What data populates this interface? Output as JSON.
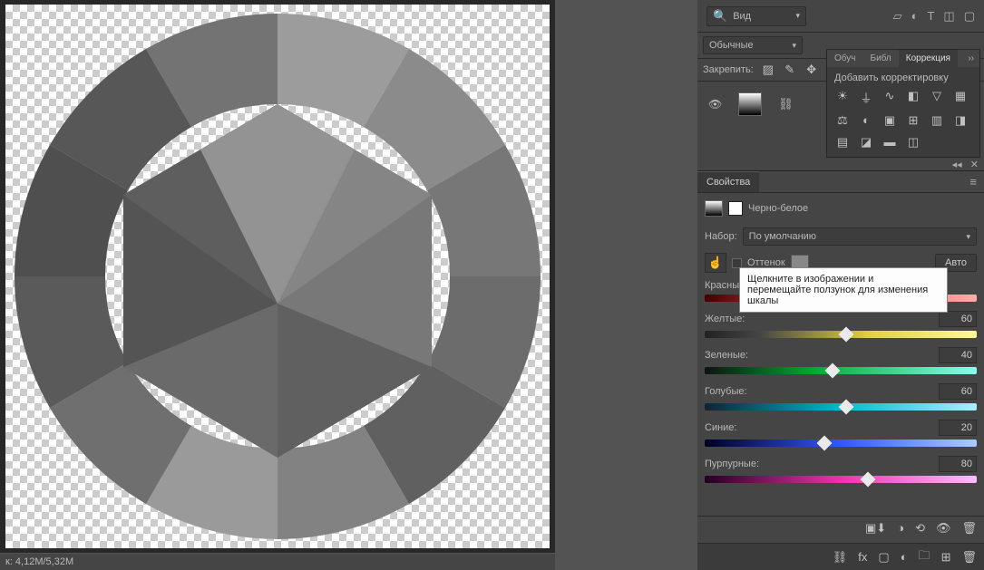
{
  "statusbar": "к: 4,12M/5,32M",
  "view_dropdown": {
    "label": "Вид",
    "icon": "🔍"
  },
  "blend_mode": "Обычные",
  "lock_label": "Закрепить:",
  "side_tabs": {
    "learn": "Обуч",
    "lib": "Библ",
    "correction": "Коррекция",
    "expand": "››"
  },
  "adjustments_title": "Добавить корректировку",
  "properties": {
    "tab": "Свойства",
    "type_label": "Черно-белое",
    "preset_label": "Набор:",
    "preset_value": "По умолчанию",
    "tint_label": "Оттенок",
    "auto_label": "Авто",
    "reds_label": "Красны"
  },
  "tooltip_text": "Щелкните в изображении и перемещайте ползунок для изменения шкалы",
  "sliders": {
    "yellow": {
      "label": "Желтые:",
      "value": "60",
      "pos": 52
    },
    "green": {
      "label": "Зеленые:",
      "value": "40",
      "pos": 47
    },
    "cyan": {
      "label": "Голубые:",
      "value": "60",
      "pos": 52
    },
    "blue": {
      "label": "Синие:",
      "value": "20",
      "pos": 44
    },
    "magenta": {
      "label": "Пурпурные:",
      "value": "80",
      "pos": 60
    }
  },
  "gradients": {
    "yellow": "linear-gradient(90deg,#222 0%,#444 20%,#e0d040 60%,#fff89a 100%)",
    "green": "linear-gradient(90deg,#111 0%,#0a3 40%,#8fe 100%)",
    "cyan": "linear-gradient(90deg,#123 0%,#0bc 50%,#aef 100%)",
    "blue": "linear-gradient(90deg,#002 0%,#35f 50%,#acf 100%)",
    "magenta": "linear-gradient(90deg,#202 0%,#e3a 50%,#fbf 100%)"
  }
}
